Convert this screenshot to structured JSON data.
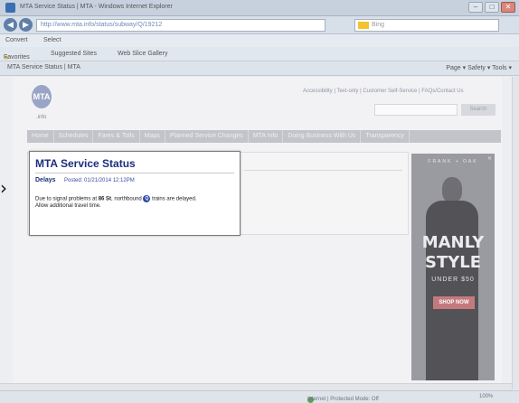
{
  "browser": {
    "window_title": "MTA Service Status | MTA - Windows Internet Explorer",
    "url": "http://www.mta.info/status/subway/Q/19212",
    "search_placeholder": "Bing",
    "menu": {
      "convert": "Convert",
      "select": "Select"
    },
    "favorites": {
      "label": "Favorites",
      "suggested": "Suggested Sites",
      "web_slice": "Web Slice Gallery"
    },
    "tab_title": "MTA Service Status | MTA",
    "tools": "Page ▾  Safety ▾  Tools ▾",
    "status_zone": "Internet | Protected Mode: Off",
    "zoom": "100%"
  },
  "site": {
    "logo_text": "MTA",
    "logo_sub": ".info",
    "top_links": "Accessibility | Text-only | Customer Self-Service | FAQs/Contact Us",
    "search_button": "Search",
    "nav": [
      "Home",
      "Schedules",
      "Fares & Tolls",
      "Maps",
      "Planned Service Changes",
      "MTA Info",
      "Doing Business With Us",
      "Transparency"
    ]
  },
  "popup": {
    "title": "MTA Service Status",
    "category": "Delays",
    "posted": "Posted: 01/21/2014 12:12PM",
    "line1_prefix": "Due to signal problems at ",
    "line1_station": "86 St",
    "line1_mid": ", northbound ",
    "train": "Q",
    "line1_suffix": " trains are delayed.",
    "line2": "Allow additional travel time."
  },
  "ad": {
    "brand": "FRANK + OAK",
    "headline1": "MANLY",
    "headline2": "STYLE",
    "subline": "UNDER $50",
    "cta": "SHOP NOW",
    "close": "✕"
  },
  "colors": {
    "accent": "#1c2f7c",
    "train_bullet": "#2a4fa6"
  }
}
